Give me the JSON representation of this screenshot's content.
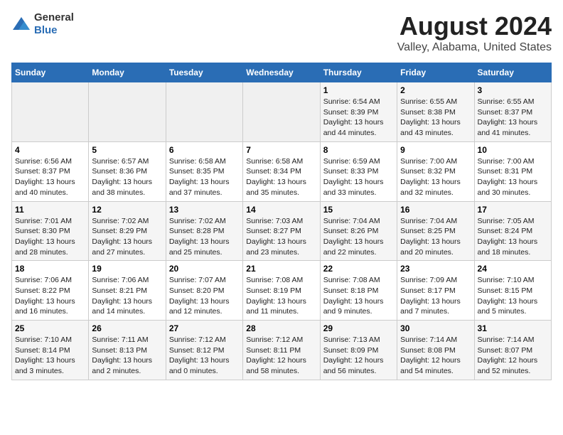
{
  "logo": {
    "general": "General",
    "blue": "Blue"
  },
  "title": "August 2024",
  "subtitle": "Valley, Alabama, United States",
  "days_of_week": [
    "Sunday",
    "Monday",
    "Tuesday",
    "Wednesday",
    "Thursday",
    "Friday",
    "Saturday"
  ],
  "weeks": [
    [
      {
        "day": "",
        "info": ""
      },
      {
        "day": "",
        "info": ""
      },
      {
        "day": "",
        "info": ""
      },
      {
        "day": "",
        "info": ""
      },
      {
        "day": "1",
        "info": "Sunrise: 6:54 AM\nSunset: 8:39 PM\nDaylight: 13 hours\nand 44 minutes."
      },
      {
        "day": "2",
        "info": "Sunrise: 6:55 AM\nSunset: 8:38 PM\nDaylight: 13 hours\nand 43 minutes."
      },
      {
        "day": "3",
        "info": "Sunrise: 6:55 AM\nSunset: 8:37 PM\nDaylight: 13 hours\nand 41 minutes."
      }
    ],
    [
      {
        "day": "4",
        "info": "Sunrise: 6:56 AM\nSunset: 8:37 PM\nDaylight: 13 hours\nand 40 minutes."
      },
      {
        "day": "5",
        "info": "Sunrise: 6:57 AM\nSunset: 8:36 PM\nDaylight: 13 hours\nand 38 minutes."
      },
      {
        "day": "6",
        "info": "Sunrise: 6:58 AM\nSunset: 8:35 PM\nDaylight: 13 hours\nand 37 minutes."
      },
      {
        "day": "7",
        "info": "Sunrise: 6:58 AM\nSunset: 8:34 PM\nDaylight: 13 hours\nand 35 minutes."
      },
      {
        "day": "8",
        "info": "Sunrise: 6:59 AM\nSunset: 8:33 PM\nDaylight: 13 hours\nand 33 minutes."
      },
      {
        "day": "9",
        "info": "Sunrise: 7:00 AM\nSunset: 8:32 PM\nDaylight: 13 hours\nand 32 minutes."
      },
      {
        "day": "10",
        "info": "Sunrise: 7:00 AM\nSunset: 8:31 PM\nDaylight: 13 hours\nand 30 minutes."
      }
    ],
    [
      {
        "day": "11",
        "info": "Sunrise: 7:01 AM\nSunset: 8:30 PM\nDaylight: 13 hours\nand 28 minutes."
      },
      {
        "day": "12",
        "info": "Sunrise: 7:02 AM\nSunset: 8:29 PM\nDaylight: 13 hours\nand 27 minutes."
      },
      {
        "day": "13",
        "info": "Sunrise: 7:02 AM\nSunset: 8:28 PM\nDaylight: 13 hours\nand 25 minutes."
      },
      {
        "day": "14",
        "info": "Sunrise: 7:03 AM\nSunset: 8:27 PM\nDaylight: 13 hours\nand 23 minutes."
      },
      {
        "day": "15",
        "info": "Sunrise: 7:04 AM\nSunset: 8:26 PM\nDaylight: 13 hours\nand 22 minutes."
      },
      {
        "day": "16",
        "info": "Sunrise: 7:04 AM\nSunset: 8:25 PM\nDaylight: 13 hours\nand 20 minutes."
      },
      {
        "day": "17",
        "info": "Sunrise: 7:05 AM\nSunset: 8:24 PM\nDaylight: 13 hours\nand 18 minutes."
      }
    ],
    [
      {
        "day": "18",
        "info": "Sunrise: 7:06 AM\nSunset: 8:22 PM\nDaylight: 13 hours\nand 16 minutes."
      },
      {
        "day": "19",
        "info": "Sunrise: 7:06 AM\nSunset: 8:21 PM\nDaylight: 13 hours\nand 14 minutes."
      },
      {
        "day": "20",
        "info": "Sunrise: 7:07 AM\nSunset: 8:20 PM\nDaylight: 13 hours\nand 12 minutes."
      },
      {
        "day": "21",
        "info": "Sunrise: 7:08 AM\nSunset: 8:19 PM\nDaylight: 13 hours\nand 11 minutes."
      },
      {
        "day": "22",
        "info": "Sunrise: 7:08 AM\nSunset: 8:18 PM\nDaylight: 13 hours\nand 9 minutes."
      },
      {
        "day": "23",
        "info": "Sunrise: 7:09 AM\nSunset: 8:17 PM\nDaylight: 13 hours\nand 7 minutes."
      },
      {
        "day": "24",
        "info": "Sunrise: 7:10 AM\nSunset: 8:15 PM\nDaylight: 13 hours\nand 5 minutes."
      }
    ],
    [
      {
        "day": "25",
        "info": "Sunrise: 7:10 AM\nSunset: 8:14 PM\nDaylight: 13 hours\nand 3 minutes."
      },
      {
        "day": "26",
        "info": "Sunrise: 7:11 AM\nSunset: 8:13 PM\nDaylight: 13 hours\nand 2 minutes."
      },
      {
        "day": "27",
        "info": "Sunrise: 7:12 AM\nSunset: 8:12 PM\nDaylight: 13 hours\nand 0 minutes."
      },
      {
        "day": "28",
        "info": "Sunrise: 7:12 AM\nSunset: 8:11 PM\nDaylight: 12 hours\nand 58 minutes."
      },
      {
        "day": "29",
        "info": "Sunrise: 7:13 AM\nSunset: 8:09 PM\nDaylight: 12 hours\nand 56 minutes."
      },
      {
        "day": "30",
        "info": "Sunrise: 7:14 AM\nSunset: 8:08 PM\nDaylight: 12 hours\nand 54 minutes."
      },
      {
        "day": "31",
        "info": "Sunrise: 7:14 AM\nSunset: 8:07 PM\nDaylight: 12 hours\nand 52 minutes."
      }
    ]
  ]
}
